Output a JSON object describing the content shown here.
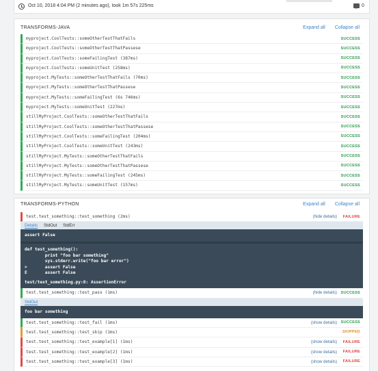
{
  "header": {
    "meta": "Oct 10, 2018 4:04 PM (2 minutes ago), took 1m 57s 225ms",
    "comment_count": "0"
  },
  "panels": {
    "java": {
      "title": "TRANSFORMS-JAVA",
      "expand_all": "Expand all",
      "collapse_all": "Collapse all",
      "rows": [
        {
          "name": "myproject.CoolTests::someOtherTestThatFails",
          "status": "SUCCESS"
        },
        {
          "name": "myproject.CoolTests::someOtherTestThatPassese",
          "status": "SUCCESS"
        },
        {
          "name": "myproject.CoolTests::someFailingTest (387ms)",
          "status": "SUCCESS"
        },
        {
          "name": "myproject.CoolTests::someUnitTest (258ms)",
          "status": "SUCCESS"
        },
        {
          "name": "myproject.MyTests::someOtherTestThatFails (70ms)",
          "status": "SUCCESS"
        },
        {
          "name": "myproject.MyTests::someOtherTestThatPassese",
          "status": "SUCCESS"
        },
        {
          "name": "myproject.MyTests::someFailingTest (6s 746ms)",
          "status": "SUCCESS"
        },
        {
          "name": "myproject.MyTests::someUnitTest (227ms)",
          "status": "SUCCESS"
        },
        {
          "name": "stillMyProject.CoolTests::someOtherTestThatFails",
          "status": "SUCCESS"
        },
        {
          "name": "stillMyProject.CoolTests::someOtherTestThatPassese",
          "status": "SUCCESS"
        },
        {
          "name": "stillMyProject.CoolTests::someFailingTest (204ms)",
          "status": "SUCCESS"
        },
        {
          "name": "stillMyProject.CoolTests::someUnitTest (243ms)",
          "status": "SUCCESS"
        },
        {
          "name": "stillMyProject.MyTests::someOtherTestThatFails",
          "status": "SUCCESS"
        },
        {
          "name": "stillMyProject.MyTests::someOtherTestThatPassese",
          "status": "SUCCESS"
        },
        {
          "name": "stillMyProject.MyTests::someFailingTest (245ms)",
          "status": "SUCCESS"
        },
        {
          "name": "stillMyProject.MyTests::someUnitTest (157ms)",
          "status": "SUCCESS"
        }
      ]
    },
    "python": {
      "title": "TRANSFORMS-PYTHON",
      "expand_all": "Expand all",
      "collapse_all": "Collapse all",
      "row1": {
        "name": "test.test_something::test_something (2ms)",
        "details": "(hide details)",
        "status": "FAILURE"
      },
      "tabs1": {
        "details": "Details",
        "stdout": "StdOut",
        "stderr": "StdErr"
      },
      "detail1": {
        "assert": "assert False",
        "code": "def test_something():\n        print \"foo bar something\"\n        sys.stderr.write(\"foo bar error\")\n>       assert False\nE       assert False",
        "location": "test/test_something.py:8: AssertionError"
      },
      "row2": {
        "name": "test.test_something::test_pass (1ms)",
        "details": "(hide details)",
        "status": "SUCCESS"
      },
      "tabs2": {
        "stdout": "StdOut"
      },
      "detail2": {
        "text": "foo bar something"
      },
      "rows": [
        {
          "name": "test.test_something::test_fail (1ms)",
          "details": "(show details)",
          "status": "SUCCESS",
          "kind": "success"
        },
        {
          "name": "test.test_something::test_skip (1ms)",
          "details": "",
          "status": "SKIPPED",
          "kind": "skip"
        },
        {
          "name": "test.test_something::test_example[1] (1ms)",
          "details": "(show details)",
          "status": "FAILURE",
          "kind": "fail"
        },
        {
          "name": "test.test_something::test_example[2] (1ms)",
          "details": "(show details)",
          "status": "FAILURE",
          "kind": "fail"
        },
        {
          "name": "test.test_something::test_example[3] (1ms)",
          "details": "(show details)",
          "status": "FAILURE",
          "kind": "fail"
        }
      ]
    }
  },
  "colors": {
    "success": "#2e9a4e",
    "failure": "#d8463f",
    "skipped": "#e08e2c",
    "link": "#3e84c6",
    "detail_bg": "#3a4a58"
  }
}
